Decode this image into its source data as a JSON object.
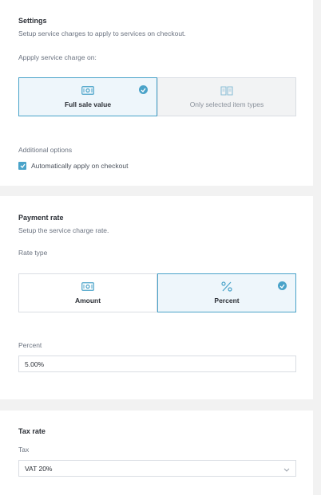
{
  "settings": {
    "title": "Settings",
    "subtitle": "Setup service charges to apply to services on checkout.",
    "apply_label": "Appply service charge on:",
    "options": [
      {
        "label": "Full sale value",
        "icon": "money-icon",
        "selected": true
      },
      {
        "label": "Only selected item types",
        "icon": "book-icon",
        "selected": false
      }
    ],
    "additional_label": "Additional options",
    "auto_apply_label": "Automatically apply on checkout",
    "auto_apply_checked": true
  },
  "payment": {
    "title": "Payment rate",
    "subtitle": "Setup the service charge rate.",
    "rate_type_label": "Rate type",
    "options": [
      {
        "label": "Amount",
        "icon": "money-icon",
        "selected": false
      },
      {
        "label": "Percent",
        "icon": "percent-icon",
        "selected": true
      }
    ],
    "percent_label": "Percent",
    "percent_value": "5.00%"
  },
  "tax": {
    "title": "Tax rate",
    "tax_label": "Tax",
    "tax_value": "VAT 20%"
  },
  "colors": {
    "accent": "#4aa3c9",
    "selected_bg": "#eef6fb",
    "background": "#f2f2f2"
  }
}
